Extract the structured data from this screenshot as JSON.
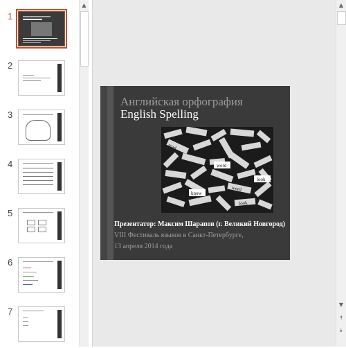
{
  "thumbnails": [
    {
      "number": "1",
      "active": true
    },
    {
      "number": "2",
      "active": false
    },
    {
      "number": "3",
      "active": false
    },
    {
      "number": "4",
      "active": false
    },
    {
      "number": "5",
      "active": false
    },
    {
      "number": "6",
      "active": false
    },
    {
      "number": "7",
      "active": false
    }
  ],
  "slide": {
    "title_ru": "Английская орфография",
    "title_en": "English Spelling",
    "presenter": "Презентатор: Максим Шарапов (г. Великий Новгород)",
    "festival": "VIII Фестиваль языков в Санкт-Петербурге,",
    "date": "13 апреля 2014 года"
  },
  "photo_words": [
    "word",
    "look",
    "know",
    "read",
    "word",
    "look"
  ],
  "colors": {
    "accent": "#c0502b",
    "slide_bg": "#3a3a3a",
    "editor_bg": "#e9e9e9"
  },
  "icons": {
    "scroll_up": "▲",
    "scroll_down": "▼",
    "prev_slide": "⯭",
    "next_slide": "⯯"
  }
}
